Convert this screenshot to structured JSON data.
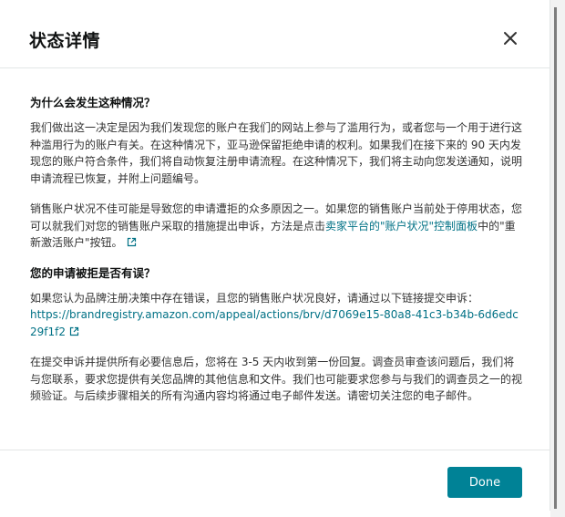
{
  "modal": {
    "title": "状态详情",
    "close_label": "×"
  },
  "section1": {
    "heading": "为什么会发生这种情况？",
    "para1": "我们做出这一决定是因为我们发现您的账户在我们的网站上参与了滥用行为，或者您与一个用于进行这种滥用行为的账户有关。在这种情况下，亚马逊保留拒绝申请的权利。如果我们在接下来的 90 天内发现您的账户符合条件，我们将自动恢复注册申请流程。在这种情况下，我们将主动向您发送通知，说明申请流程已恢复，并附上问题编号。",
    "para2_part1": "销售账户状况不佳可能是导致您的申请遭拒的众多原因之一。如果您的销售账户当前处于停用状态，您可以就我们对您的销售账户采取的措施提出申诉，方法是点击",
    "para2_link": "卖家平台的\"账户状况\"控制面板",
    "para2_part2": "中的\"重新激活账户\"按钮。"
  },
  "section2": {
    "heading": "您的申请被拒是否有误？",
    "para1_text": "如果您认为品牌注册决策中存在错误，且您的销售账户状况良好，请通过以下链接提交申诉：",
    "para1_link": "https://brandregistry.amazon.com/appeal/actions/brv/d7069e15-80a8-41c3-b34b-6d6edc29f1f2",
    "para2": "在提交申诉并提供所有必要信息后，您将在 3-5 天内收到第一份回复。调查员审查该问题后，我们将与您联系，要求您提供有关您品牌的其他信息和文件。我们也可能要求您参与与我们的调查员之一的视频验证。与后续步骤相关的所有沟通内容均将通过电子邮件发送。请密切关注您的电子邮件。"
  },
  "footer": {
    "done_label": "Done"
  },
  "icons": {
    "close": "close-icon",
    "external_link": "external-link-icon"
  },
  "colors": {
    "link": "#007185",
    "primary_button": "#008296",
    "title": "#0f1111",
    "body_text": "#333333"
  }
}
